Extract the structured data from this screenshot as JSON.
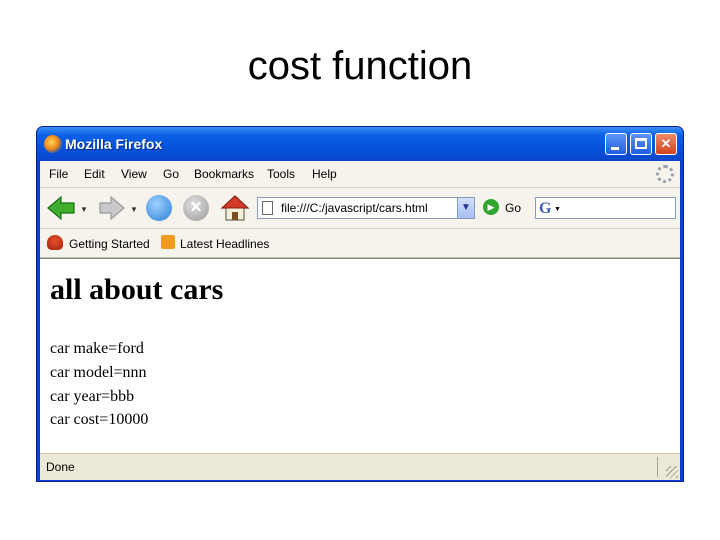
{
  "slide": {
    "title": "cost function"
  },
  "window": {
    "title": "Mozilla Firefox",
    "controls": {
      "minimize": "",
      "maximize": "",
      "close": "✕"
    }
  },
  "menubar": {
    "items": [
      {
        "label": "File"
      },
      {
        "label": "Edit"
      },
      {
        "label": "View"
      },
      {
        "label": "Go"
      },
      {
        "label": "Bookmarks"
      },
      {
        "label": "Tools"
      },
      {
        "label": "Help"
      }
    ]
  },
  "navbar": {
    "address": "file:///C:/javascript/cars.html",
    "go_label": "Go",
    "search_value": ""
  },
  "bookmarks": {
    "items": [
      {
        "label": "Getting Started",
        "icon": "firefox-gs-icon"
      },
      {
        "label": "Latest Headlines",
        "icon": "rss-icon"
      }
    ]
  },
  "page": {
    "heading": "all about cars",
    "lines": [
      "car make=ford",
      "car model=nnn",
      "car year=bbb",
      "car cost=10000"
    ]
  },
  "status": {
    "text": "Done"
  },
  "colors": {
    "titlebar": "#0650d8",
    "chrome": "#ece9d8",
    "close_button": "#d2431d"
  }
}
